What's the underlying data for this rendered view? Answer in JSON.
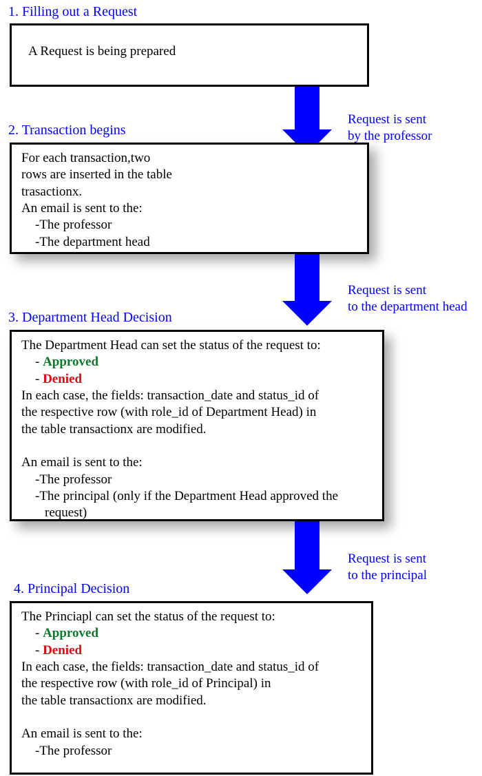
{
  "steps": {
    "s1": {
      "heading": "1. Filling out a Request",
      "body": "A Request is being prepared"
    },
    "s2": {
      "heading": "2. Transaction begins",
      "line1": "For each transaction,two",
      "line2": "rows are inserted in the table",
      "line3": "trasactionx.",
      "line4": "An email is sent to the:",
      "line5": "-The professor",
      "line6": "-The department head"
    },
    "s3": {
      "heading": "3. Department Head Decision",
      "line1": "The Department Head can set the status of the request to:",
      "bullet_dash": "- ",
      "approved": "Approved",
      "denied": "Denied",
      "line4": "In each case, the fields: transaction_date and status_id of",
      "line5": "the respective row (with role_id of Department Head) in",
      "line6": "the table transactionx are modified.",
      "blank": " ",
      "line8": "An email is sent to the:",
      "line9": "-The professor",
      "line10": "-The principal (only if the Department Head approved the",
      "line11": " request)"
    },
    "s4": {
      "heading": "4. Principal Decision",
      "line1": "The Princiapl can set the status of the request to:",
      "bullet_dash": "- ",
      "approved": "Approved",
      "denied": "Denied",
      "line4": "In each case, the fields: transaction_date and status_id of",
      "line5": "the respective row (with role_id of Principal) in",
      "line6": "the table transactionx are modified.",
      "blank": " ",
      "line8": "An email is sent to the:",
      "line9": "-The professor"
    }
  },
  "arrows": {
    "a1": {
      "label_line1": "Request is sent",
      "label_line2": "by the professor"
    },
    "a2": {
      "label_line1": "Request is sent",
      "label_line2": "to the department head"
    },
    "a3": {
      "label_line1": "Request is sent",
      "label_line2": "to the principal"
    }
  },
  "colors": {
    "accent_blue": "#0000ff",
    "approved_green": "#0a7a2a",
    "denied_red": "#e30613"
  }
}
